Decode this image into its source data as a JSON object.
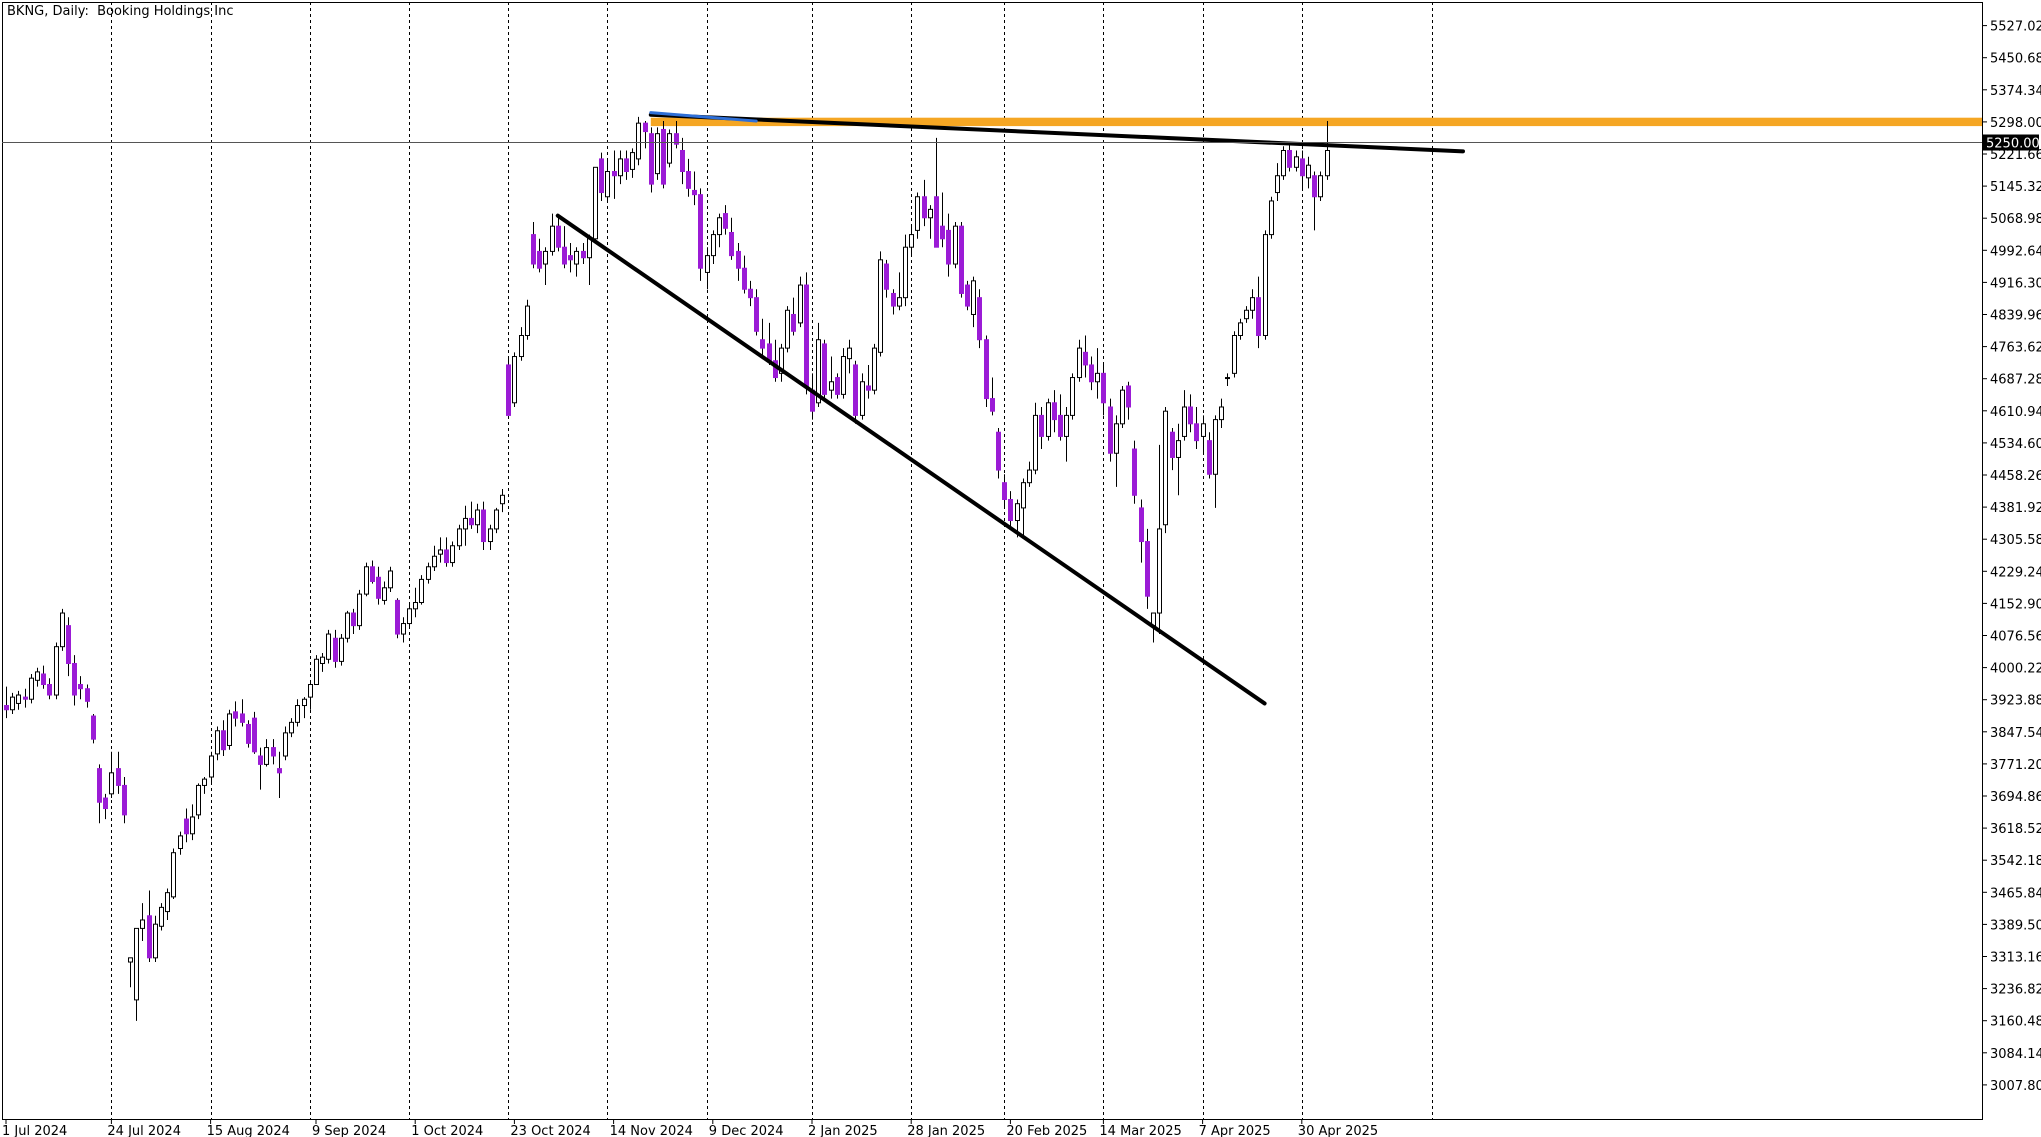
{
  "header": {
    "symbol": "BKNG",
    "timeframe": "Daily:",
    "company": "Booking Holdings Inc"
  },
  "colors": {
    "background": "#ffffff",
    "bull_candle_fill": "#ffffff",
    "bear_candle_fill": "#9b1bd6",
    "candle_outline": "#000000",
    "wick": "#000000",
    "resistance_band": "#f5a623",
    "blue_line": "#2f6fd6",
    "trendline": "#000000",
    "price_marker_bg": "#000000",
    "price_marker_text": "#ffffff"
  },
  "chart_data": {
    "type": "candlestick",
    "grid": {
      "vertical": "dashed",
      "horizontal": false
    },
    "current_price_label": "5250.00",
    "current_price": 5250.0,
    "y_ticks": [
      "5527.02",
      "5450.68",
      "5374.34",
      "5298.00",
      "5221.66",
      "5145.32",
      "5068.98",
      "4992.64",
      "4916.30",
      "4839.96",
      "4763.62",
      "4687.28",
      "4610.94",
      "4534.60",
      "4458.26",
      "4381.92",
      "4305.58",
      "4229.24",
      "4152.90",
      "4076.56",
      "4000.22",
      "3923.88",
      "3847.54",
      "3771.20",
      "3694.86",
      "3618.52",
      "3542.18",
      "3465.84",
      "3389.50",
      "3313.16",
      "3236.82",
      "3160.48",
      "3084.14",
      "3007.80"
    ],
    "x_labels": [
      {
        "label": "1 Jul 2024",
        "index": 0
      },
      {
        "label": "24 Jul 2024",
        "index": 17
      },
      {
        "label": "15 Aug 2024",
        "index": 33
      },
      {
        "label": "9 Sep 2024",
        "index": 50
      },
      {
        "label": "1 Oct 2024",
        "index": 66
      },
      {
        "label": "23 Oct 2024",
        "index": 82
      },
      {
        "label": "14 Nov 2024",
        "index": 98
      },
      {
        "label": "9 Dec 2024",
        "index": 114
      },
      {
        "label": "2 Jan 2025",
        "index": 130
      },
      {
        "label": "28 Jan 2025",
        "index": 146
      },
      {
        "label": "20 Feb 2025",
        "index": 162
      },
      {
        "label": "14 Mar 2025",
        "index": 177
      },
      {
        "label": "7 Apr 2025",
        "index": 193
      },
      {
        "label": "30 Apr 2025",
        "index": 209
      }
    ],
    "vgrid_indices": [
      17,
      33,
      49,
      65,
      81,
      97,
      113,
      130,
      146,
      161,
      177,
      193,
      209,
      230
    ],
    "future_bars": 18,
    "candles": [
      [
        3910,
        3955,
        3880,
        3900
      ],
      [
        3900,
        3940,
        3890,
        3930
      ],
      [
        3915,
        3945,
        3900,
        3935
      ],
      [
        3930,
        3950,
        3905,
        3925
      ],
      [
        3925,
        3985,
        3915,
        3975
      ],
      [
        3970,
        4000,
        3955,
        3990
      ],
      [
        3985,
        4005,
        3950,
        3960
      ],
      [
        3960,
        3975,
        3925,
        3935
      ],
      [
        3935,
        4060,
        3925,
        4050
      ],
      [
        4050,
        4140,
        4040,
        4130
      ],
      [
        4100,
        4120,
        3980,
        4010
      ],
      [
        4010,
        4030,
        3910,
        3935
      ],
      [
        3960,
        3980,
        3925,
        3950
      ],
      [
        3950,
        3960,
        3905,
        3920
      ],
      [
        3885,
        3890,
        3820,
        3830
      ],
      [
        3760,
        3770,
        3630,
        3680
      ],
      [
        3690,
        3700,
        3640,
        3665
      ],
      [
        3700,
        3800,
        3690,
        3750
      ],
      [
        3760,
        3800,
        3700,
        3720
      ],
      [
        3720,
        3740,
        3630,
        3650
      ],
      [
        3300,
        3310,
        3240,
        3310
      ],
      [
        3210,
        3380,
        3160,
        3380
      ],
      [
        3380,
        3440,
        3350,
        3400
      ],
      [
        3410,
        3470,
        3300,
        3310
      ],
      [
        3310,
        3410,
        3300,
        3390
      ],
      [
        3385,
        3440,
        3375,
        3430
      ],
      [
        3420,
        3475,
        3400,
        3465
      ],
      [
        3455,
        3570,
        3450,
        3560
      ],
      [
        3570,
        3610,
        3555,
        3600
      ],
      [
        3640,
        3665,
        3585,
        3605
      ],
      [
        3605,
        3675,
        3590,
        3645
      ],
      [
        3650,
        3725,
        3640,
        3720
      ],
      [
        3720,
        3740,
        3700,
        3735
      ],
      [
        3740,
        3800,
        3725,
        3790
      ],
      [
        3795,
        3860,
        3780,
        3850
      ],
      [
        3850,
        3875,
        3790,
        3805
      ],
      [
        3815,
        3900,
        3805,
        3890
      ],
      [
        3895,
        3920,
        3860,
        3880
      ],
      [
        3890,
        3925,
        3860,
        3870
      ],
      [
        3865,
        3875,
        3810,
        3820
      ],
      [
        3880,
        3895,
        3795,
        3800
      ],
      [
        3790,
        3810,
        3710,
        3770
      ],
      [
        3770,
        3830,
        3765,
        3810
      ],
      [
        3810,
        3830,
        3770,
        3790
      ],
      [
        3760,
        3800,
        3690,
        3750
      ],
      [
        3790,
        3860,
        3780,
        3845
      ],
      [
        3845,
        3880,
        3835,
        3870
      ],
      [
        3870,
        3925,
        3860,
        3910
      ],
      [
        3910,
        3930,
        3880,
        3925
      ],
      [
        3930,
        3965,
        3900,
        3960
      ],
      [
        3960,
        4030,
        3960,
        4020
      ],
      [
        4010,
        4035,
        3990,
        4025
      ],
      [
        4020,
        4090,
        4010,
        4080
      ],
      [
        4070,
        4090,
        4000,
        4015
      ],
      [
        4015,
        4080,
        4005,
        4070
      ],
      [
        4070,
        4135,
        4060,
        4130
      ],
      [
        4130,
        4140,
        4080,
        4100
      ],
      [
        4100,
        4185,
        4090,
        4175
      ],
      [
        4175,
        4250,
        4170,
        4240
      ],
      [
        4240,
        4255,
        4200,
        4205
      ],
      [
        4215,
        4240,
        4150,
        4165
      ],
      [
        4160,
        4205,
        4150,
        4190
      ],
      [
        4190,
        4240,
        4180,
        4230
      ],
      [
        4160,
        4165,
        4070,
        4080
      ],
      [
        4080,
        4120,
        4060,
        4105
      ],
      [
        4105,
        4150,
        4095,
        4140
      ],
      [
        4140,
        4190,
        4120,
        4155
      ],
      [
        4155,
        4220,
        4150,
        4210
      ],
      [
        4210,
        4250,
        4200,
        4240
      ],
      [
        4240,
        4290,
        4230,
        4265
      ],
      [
        4270,
        4310,
        4250,
        4280
      ],
      [
        4280,
        4310,
        4240,
        4250
      ],
      [
        4250,
        4300,
        4240,
        4290
      ],
      [
        4290,
        4340,
        4280,
        4330
      ],
      [
        4330,
        4385,
        4290,
        4355
      ],
      [
        4355,
        4395,
        4330,
        4340
      ],
      [
        4340,
        4390,
        4320,
        4375
      ],
      [
        4375,
        4395,
        4280,
        4300
      ],
      [
        4300,
        4340,
        4280,
        4330
      ],
      [
        4330,
        4380,
        4320,
        4375
      ],
      [
        4390,
        4425,
        4370,
        4410
      ],
      [
        4720,
        4740,
        4600,
        4600
      ],
      [
        4630,
        4750,
        4620,
        4740
      ],
      [
        4740,
        4810,
        4730,
        4790
      ],
      [
        4790,
        4875,
        4780,
        4860
      ],
      [
        5030,
        5060,
        4950,
        4960
      ],
      [
        4990,
        5020,
        4940,
        4950
      ],
      [
        4960,
        5000,
        4910,
        4990
      ],
      [
        4990,
        5080,
        4980,
        5050
      ],
      [
        5050,
        5070,
        4990,
        5000
      ],
      [
        5000,
        5050,
        4950,
        4960
      ],
      [
        4980,
        5010,
        4940,
        4970
      ],
      [
        4960,
        5000,
        4930,
        4990
      ],
      [
        4990,
        5010,
        4960,
        4975
      ],
      [
        4975,
        5030,
        4910,
        5020
      ],
      [
        5020,
        5190,
        5010,
        5190
      ],
      [
        5210,
        5225,
        5110,
        5130
      ],
      [
        5120,
        5210,
        5110,
        5180
      ],
      [
        5180,
        5230,
        5115,
        5170
      ],
      [
        5170,
        5230,
        5150,
        5210
      ],
      [
        5210,
        5230,
        5160,
        5180
      ],
      [
        5185,
        5235,
        5165,
        5225
      ],
      [
        5210,
        5310,
        5195,
        5295
      ],
      [
        5295,
        5300,
        5235,
        5275
      ],
      [
        5270,
        5285,
        5130,
        5150
      ],
      [
        5175,
        5285,
        5160,
        5270
      ],
      [
        5280,
        5300,
        5140,
        5150
      ],
      [
        5200,
        5280,
        5190,
        5270
      ],
      [
        5270,
        5300,
        5235,
        5245
      ],
      [
        5230,
        5260,
        5150,
        5180
      ],
      [
        5180,
        5210,
        5120,
        5140
      ],
      [
        5135,
        5180,
        5100,
        5125
      ],
      [
        5125,
        5140,
        4920,
        4950
      ],
      [
        4940,
        5000,
        4900,
        4980
      ],
      [
        4980,
        5040,
        4960,
        5030
      ],
      [
        5030,
        5080,
        5000,
        5070
      ],
      [
        5080,
        5100,
        5030,
        5045
      ],
      [
        5035,
        5070,
        4970,
        4980
      ],
      [
        4990,
        5010,
        4920,
        4950
      ],
      [
        4950,
        4980,
        4890,
        4900
      ],
      [
        4900,
        4920,
        4860,
        4880
      ],
      [
        4880,
        4900,
        4790,
        4800
      ],
      [
        4780,
        4830,
        4740,
        4760
      ],
      [
        4770,
        4820,
        4720,
        4730
      ],
      [
        4730,
        4780,
        4680,
        4690
      ],
      [
        4700,
        4770,
        4680,
        4760
      ],
      [
        4760,
        4860,
        4750,
        4850
      ],
      [
        4840,
        4880,
        4790,
        4800
      ],
      [
        4820,
        4930,
        4810,
        4910
      ],
      [
        4910,
        4940,
        4650,
        4670
      ],
      [
        4660,
        4700,
        4590,
        4610
      ],
      [
        4630,
        4820,
        4620,
        4780
      ],
      [
        4770,
        4780,
        4640,
        4650
      ],
      [
        4660,
        4740,
        4640,
        4680
      ],
      [
        4690,
        4700,
        4640,
        4650
      ],
      [
        4650,
        4760,
        4640,
        4740
      ],
      [
        4735,
        4780,
        4700,
        4760
      ],
      [
        4720,
        4730,
        4580,
        4600
      ],
      [
        4600,
        4700,
        4590,
        4680
      ],
      [
        4670,
        4720,
        4640,
        4660
      ],
      [
        4660,
        4770,
        4650,
        4760
      ],
      [
        4750,
        4990,
        4740,
        4970
      ],
      [
        4960,
        4970,
        4880,
        4900
      ],
      [
        4890,
        4900,
        4840,
        4860
      ],
      [
        4860,
        4940,
        4850,
        4880
      ],
      [
        4880,
        5030,
        4860,
        5000
      ],
      [
        5000,
        5050,
        4980,
        5030
      ],
      [
        5040,
        5130,
        5020,
        5120
      ],
      [
        5120,
        5160,
        5050,
        5070
      ],
      [
        5070,
        5100,
        5020,
        5090
      ],
      [
        5120,
        5260,
        5000,
        5000
      ],
      [
        5050,
        5130,
        5000,
        5020
      ],
      [
        5040,
        5080,
        4930,
        4960
      ],
      [
        4960,
        5060,
        4950,
        5050
      ],
      [
        5050,
        5060,
        4880,
        4890
      ],
      [
        4910,
        4920,
        4850,
        4860
      ],
      [
        4840,
        4930,
        4810,
        4920
      ],
      [
        4880,
        4900,
        4760,
        4780
      ],
      [
        4780,
        4790,
        4620,
        4640
      ],
      [
        4640,
        4690,
        4600,
        4610
      ],
      [
        4560,
        4570,
        4450,
        4470
      ],
      [
        4440,
        4460,
        4380,
        4400
      ],
      [
        4400,
        4420,
        4330,
        4350
      ],
      [
        4350,
        4400,
        4310,
        4390
      ],
      [
        4380,
        4450,
        4310,
        4440
      ],
      [
        4440,
        4490,
        4430,
        4470
      ],
      [
        4470,
        4630,
        4460,
        4600
      ],
      [
        4600,
        4620,
        4520,
        4550
      ],
      [
        4550,
        4640,
        4540,
        4630
      ],
      [
        4630,
        4660,
        4560,
        4590
      ],
      [
        4600,
        4650,
        4540,
        4550
      ],
      [
        4550,
        4620,
        4490,
        4600
      ],
      [
        4600,
        4700,
        4590,
        4690
      ],
      [
        4690,
        4780,
        4680,
        4760
      ],
      [
        4750,
        4790,
        4690,
        4720
      ],
      [
        4720,
        4740,
        4660,
        4680
      ],
      [
        4680,
        4760,
        4640,
        4700
      ],
      [
        4700,
        4720,
        4600,
        4630
      ],
      [
        4620,
        4640,
        4490,
        4510
      ],
      [
        4510,
        4600,
        4430,
        4580
      ],
      [
        4580,
        4670,
        4570,
        4660
      ],
      [
        4670,
        4680,
        4590,
        4620
      ],
      [
        4520,
        4540,
        4390,
        4410
      ],
      [
        4380,
        4400,
        4250,
        4300
      ],
      [
        4300,
        4330,
        4140,
        4170
      ],
      [
        4100,
        4120,
        4060,
        4130
      ],
      [
        4130,
        4530,
        4080,
        4330
      ],
      [
        4340,
        4620,
        4320,
        4610
      ],
      [
        4560,
        4570,
        4470,
        4500
      ],
      [
        4500,
        4580,
        4410,
        4540
      ],
      [
        4550,
        4660,
        4540,
        4620
      ],
      [
        4620,
        4650,
        4560,
        4580
      ],
      [
        4580,
        4620,
        4520,
        4540
      ],
      [
        4550,
        4600,
        4510,
        4580
      ],
      [
        4540,
        4560,
        4450,
        4460
      ],
      [
        4460,
        4600,
        4380,
        4590
      ],
      [
        4590,
        4640,
        4570,
        4620
      ],
      [
        4690,
        4700,
        4670,
        4690
      ],
      [
        4700,
        4800,
        4690,
        4790
      ],
      [
        4790,
        4830,
        4780,
        4820
      ],
      [
        4830,
        4860,
        4820,
        4850
      ],
      [
        4850,
        4900,
        4830,
        4880
      ],
      [
        4880,
        4930,
        4760,
        4790
      ],
      [
        4790,
        5040,
        4780,
        5030
      ],
      [
        5030,
        5120,
        5020,
        5110
      ],
      [
        5130,
        5200,
        5110,
        5170
      ],
      [
        5170,
        5240,
        5160,
        5230
      ],
      [
        5230,
        5250,
        5180,
        5190
      ],
      [
        5190,
        5230,
        5180,
        5215
      ],
      [
        5210,
        5230,
        5140,
        5170
      ],
      [
        5165,
        5215,
        5140,
        5195
      ],
      [
        5170,
        5180,
        5040,
        5120
      ],
      [
        5120,
        5180,
        5110,
        5170
      ],
      [
        5170,
        5300,
        5160,
        5230
      ]
    ],
    "trendlines": [
      {
        "name": "resistance-trendline",
        "color": "#000000",
        "from": {
          "index": 104,
          "price": 5315
        },
        "to": {
          "index": 235,
          "price": 5228
        }
      },
      {
        "name": "support-trendline",
        "color": "#000000",
        "from": {
          "index": 89,
          "price": 5075
        },
        "to": {
          "index": 203,
          "price": 3915
        }
      },
      {
        "name": "blue-segment",
        "color": "#2f6fd6",
        "from": {
          "index": 104,
          "price": 5320
        },
        "to": {
          "index": 121,
          "price": 5300
        }
      }
    ],
    "resistance_band": {
      "from_index": 104,
      "to": "right-edge",
      "low": 5288,
      "high": 5308
    }
  }
}
